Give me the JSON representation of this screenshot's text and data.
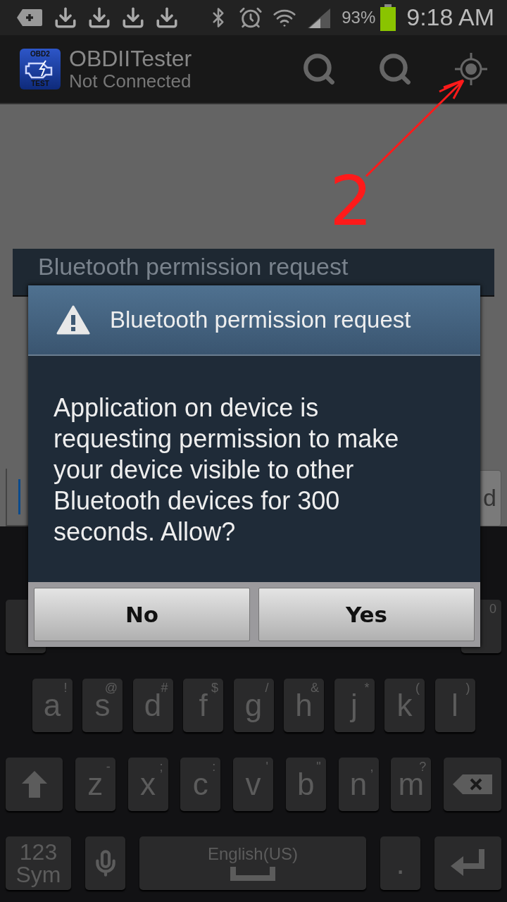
{
  "status_bar": {
    "battery": "93%",
    "time": "9:18 AM"
  },
  "action_bar": {
    "logo_top": "OBD2",
    "logo_bottom": "TEST",
    "title": "OBDIITester",
    "subtitle": "Not Connected"
  },
  "background": {
    "dialog_title": "Bluetooth permission request",
    "button_label": "d"
  },
  "dialog": {
    "title": "Bluetooth permission request",
    "message": "Application on device is requesting permission to make your device visible to other Bluetooth devices for 300 seconds. Allow?",
    "buttons": [
      {
        "label": "No"
      },
      {
        "label": "Yes"
      }
    ]
  },
  "annotation": {
    "label": "2"
  },
  "keyboard": {
    "number_row": [
      {
        "kind": "letter"
      },
      {
        "kind": "letter",
        "hint": "0"
      }
    ],
    "home_row": [
      {
        "kind": "letter",
        "label": "a",
        "hint": "!"
      },
      {
        "kind": "letter",
        "label": "s",
        "hint": "@"
      },
      {
        "kind": "letter",
        "label": "d",
        "hint": "#"
      },
      {
        "kind": "letter",
        "label": "f",
        "hint": "$"
      },
      {
        "kind": "letter",
        "label": "g",
        "hint": "/"
      },
      {
        "kind": "letter",
        "label": "h",
        "hint": "&"
      },
      {
        "kind": "letter",
        "label": "j",
        "hint": "*"
      },
      {
        "kind": "letter",
        "label": "k",
        "hint": "("
      },
      {
        "kind": "letter",
        "label": "l",
        "hint": ")"
      }
    ],
    "bottom_row": [
      {
        "kind": "shift"
      },
      {
        "kind": "letter",
        "label": "z",
        "hint": "-"
      },
      {
        "kind": "letter",
        "label": "x",
        "hint": ";"
      },
      {
        "kind": "letter",
        "label": "c",
        "hint": ":"
      },
      {
        "kind": "letter",
        "label": "v",
        "hint": "'"
      },
      {
        "kind": "letter",
        "label": "b",
        "hint": "\""
      },
      {
        "kind": "letter",
        "label": "n",
        "hint": ","
      },
      {
        "kind": "letter",
        "label": "m",
        "hint": "?"
      },
      {
        "kind": "backspace"
      }
    ],
    "function_row": [
      {
        "kind": "sym",
        "label": "123",
        "sublabel": "Sym"
      },
      {
        "kind": "mic"
      },
      {
        "kind": "space",
        "label": "English(US)"
      },
      {
        "kind": "period",
        "label": "."
      },
      {
        "kind": "enter"
      }
    ]
  }
}
